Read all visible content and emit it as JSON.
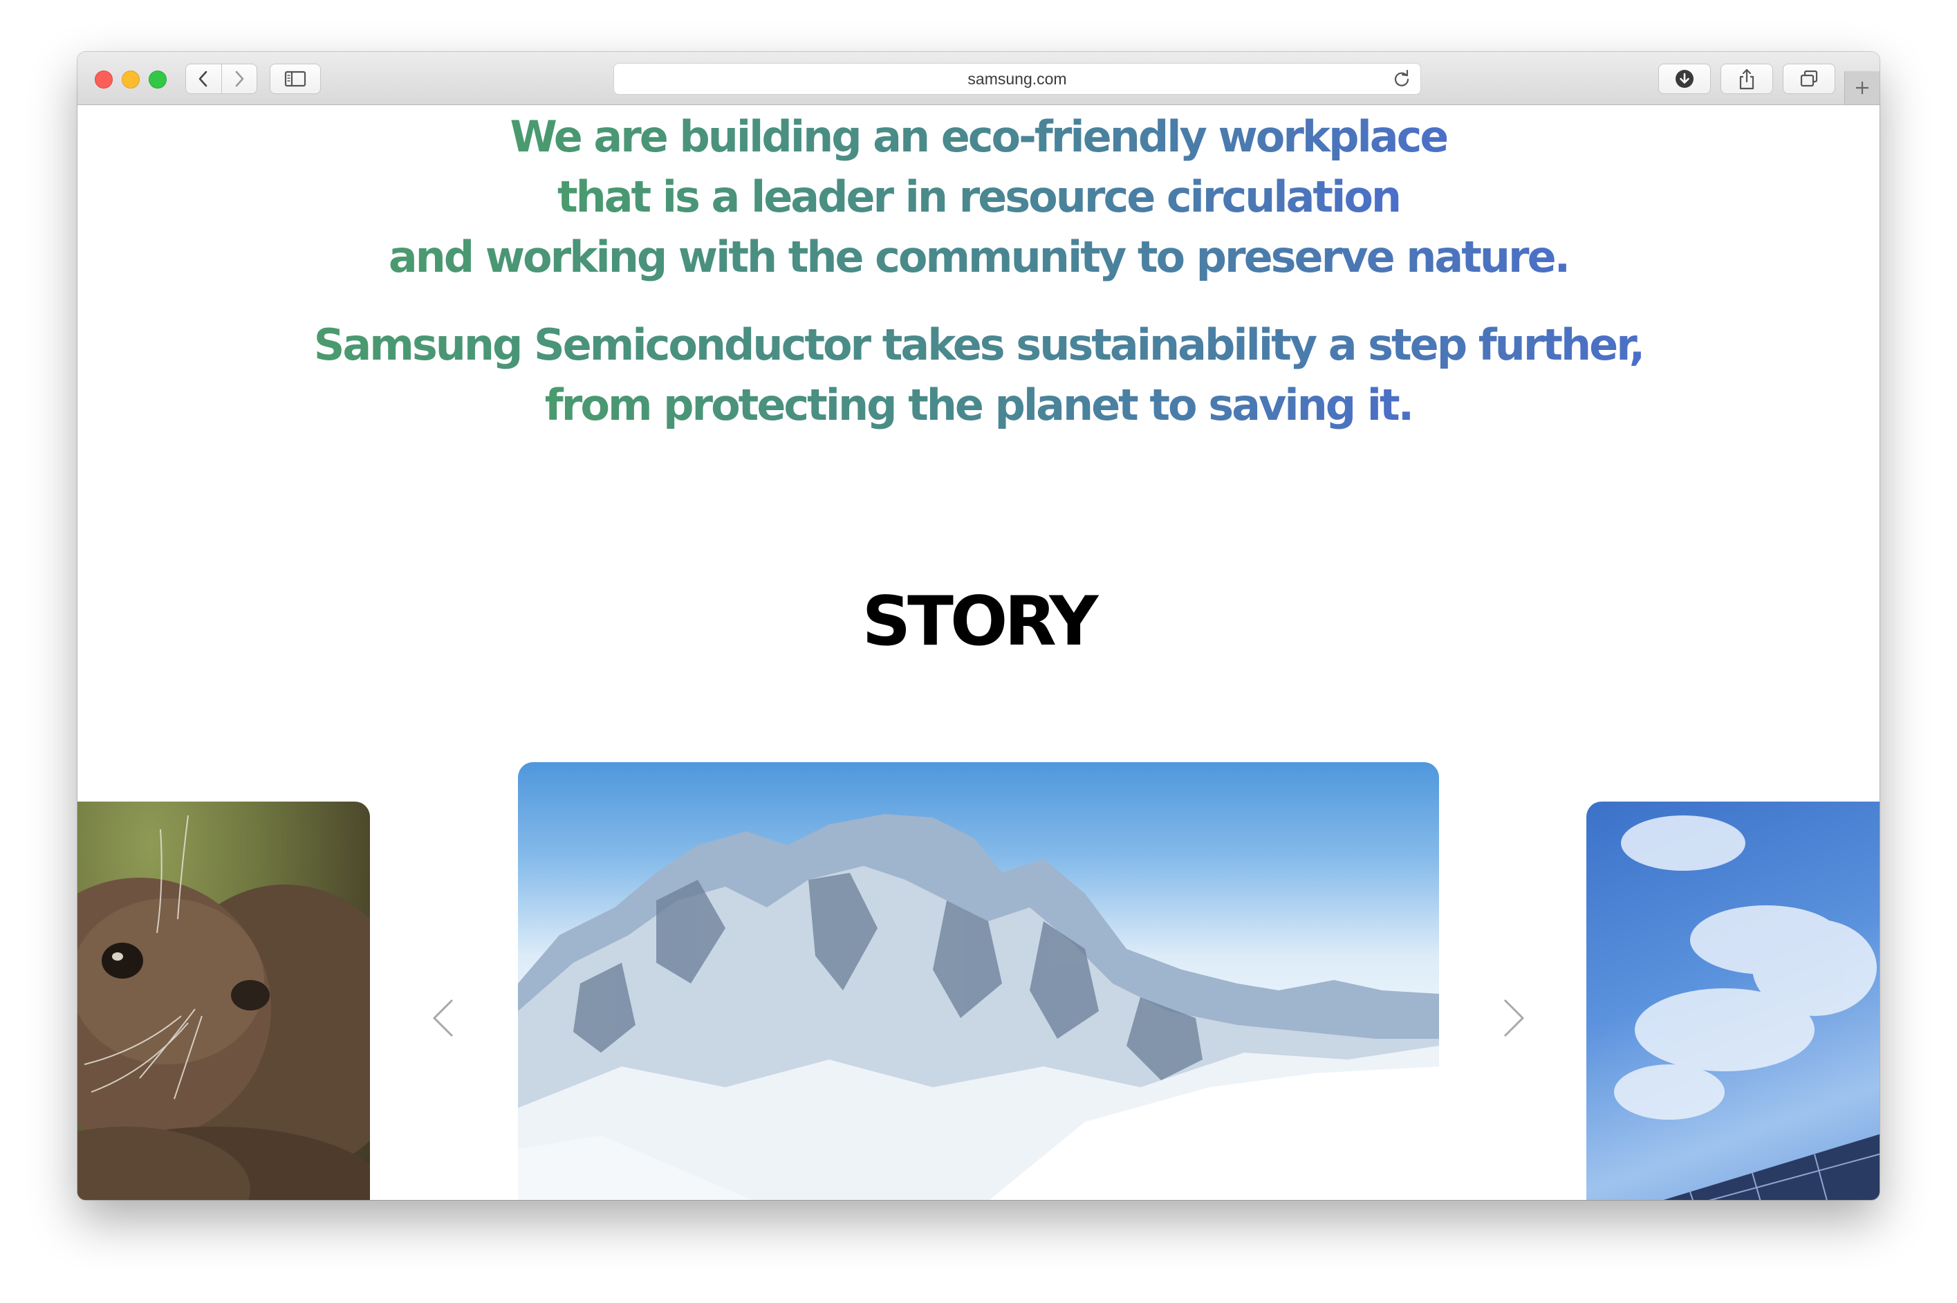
{
  "browser": {
    "url": "samsung.com"
  },
  "mission": {
    "lines": [
      [
        "We are building an eco-friendly workplace"
      ],
      [
        "that is a leader in resource circulation"
      ],
      [
        "and working with the community to preserve nature."
      ],
      [
        "Samsung Semiconductor takes sustainability a step further,"
      ],
      [
        "from protecting the planet to saving it."
      ]
    ]
  },
  "story": {
    "title": "STORY",
    "cards": [
      {
        "subject": "otter"
      },
      {
        "subject": "snowy mountain"
      },
      {
        "subject": "solar panels under blue sky"
      }
    ]
  },
  "colors": {
    "gradient_start": "#4a9a6e",
    "gradient_mid": "#4a8a8a",
    "gradient_end": "#4b6fc8",
    "heading": "#000000"
  }
}
